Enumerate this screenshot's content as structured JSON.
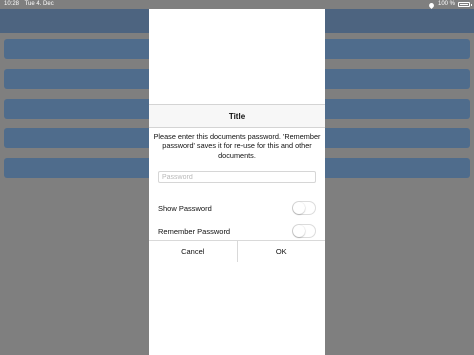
{
  "status_bar": {
    "time": "10:28",
    "date": "Tue 4. Dec",
    "battery": "100 %"
  },
  "dialog": {
    "title": "Title",
    "message": "Please enter this documents password. 'Remember password' saves it for re-use for this and other documents.",
    "password_placeholder": "Password",
    "password_value": "",
    "toggles": [
      {
        "label": "Show Password",
        "on": false
      },
      {
        "label": "Remember Password",
        "on": false
      }
    ],
    "cancel_label": "Cancel",
    "ok_label": "OK"
  },
  "colors": {
    "header": "#4d6480",
    "row": "#4f6c8c",
    "dim_background": "#7f7f7f"
  }
}
